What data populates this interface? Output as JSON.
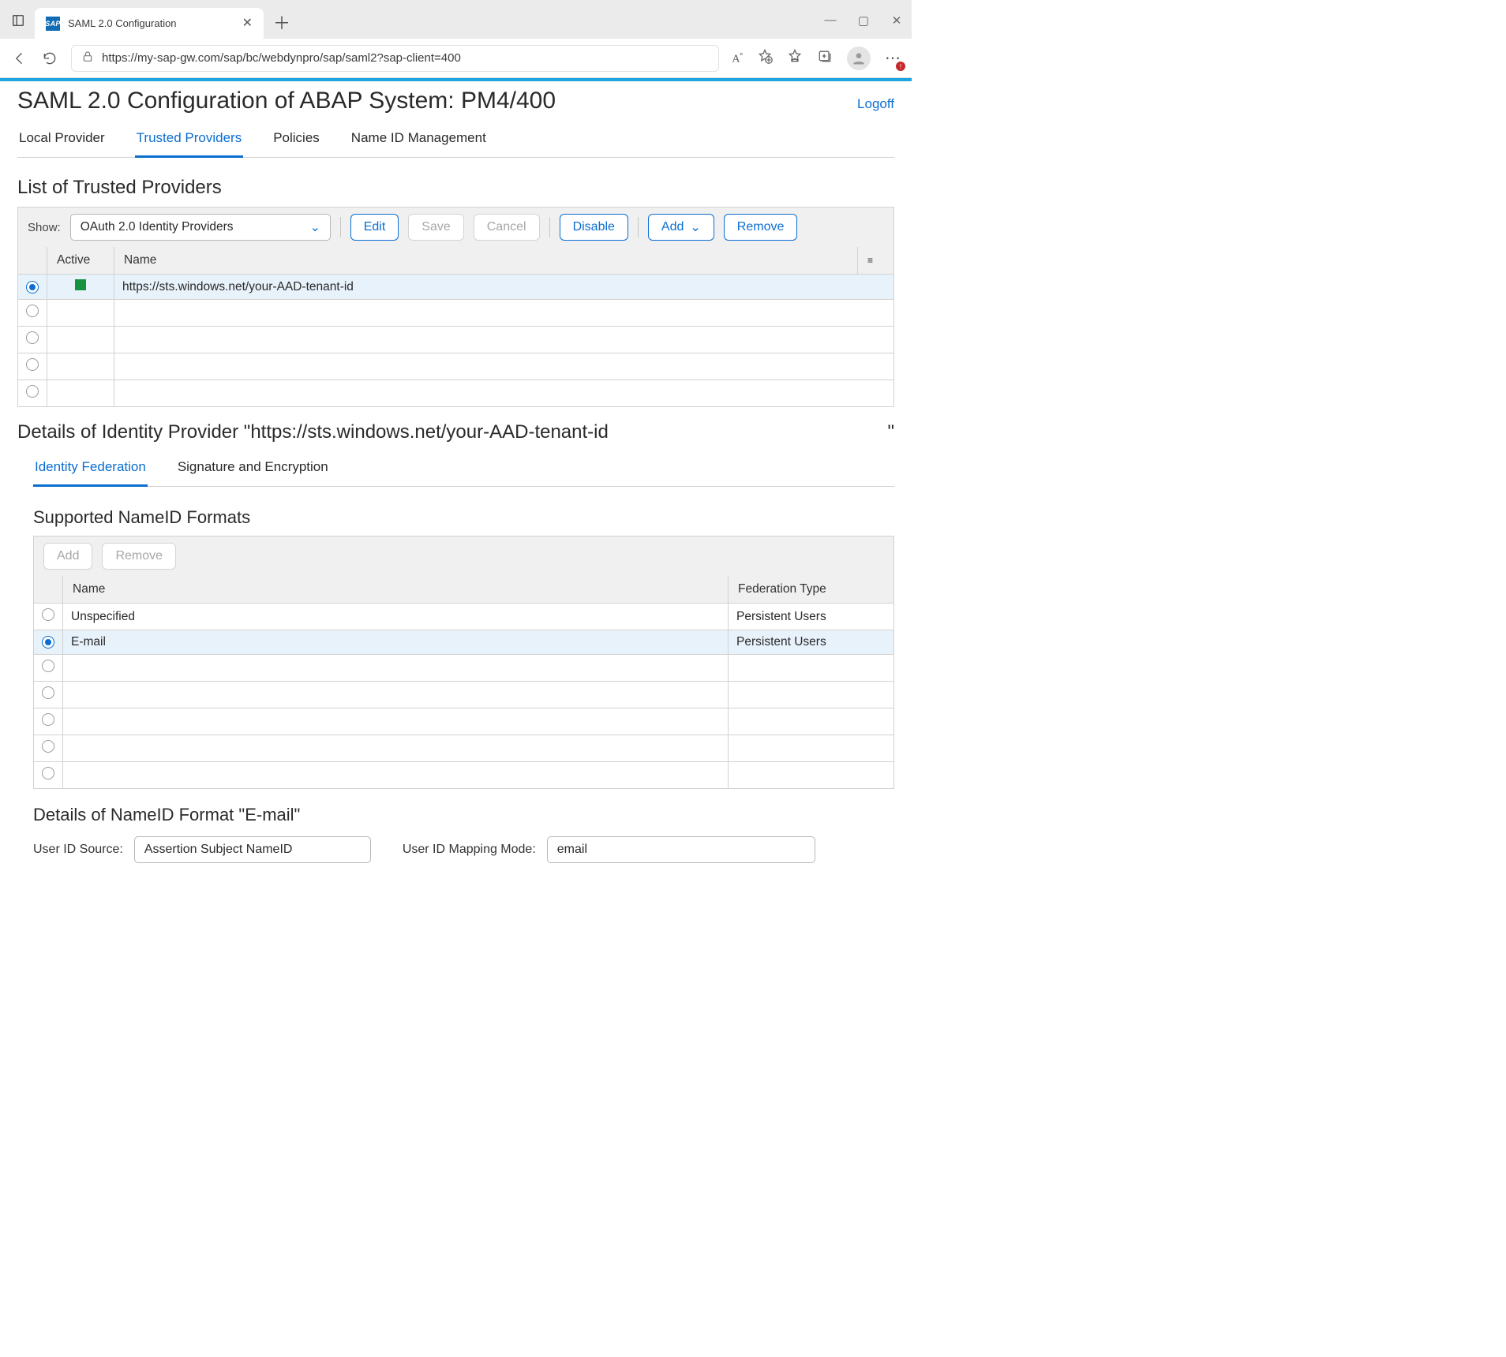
{
  "browser": {
    "tab_title": "SAML 2.0 Configuration",
    "url": "https://my-sap-gw.com/sap/bc/webdynpro/sap/saml2?sap-client=400"
  },
  "header": {
    "title": "SAML 2.0 Configuration of ABAP System: PM4/400",
    "logoff": "Logoff",
    "tabs": [
      "Local Provider",
      "Trusted Providers",
      "Policies",
      "Name ID Management"
    ],
    "active_tab_index": 1
  },
  "trusted": {
    "section_title": "List of Trusted Providers",
    "show_label": "Show:",
    "select_value": "OAuth 2.0 Identity Providers",
    "buttons": {
      "edit": "Edit",
      "save": "Save",
      "cancel": "Cancel",
      "disable": "Disable",
      "add": "Add",
      "remove": "Remove"
    },
    "columns": {
      "active": "Active",
      "name": "Name"
    },
    "rows": [
      {
        "selected": true,
        "active": true,
        "name_prefix": "https://sts.windows.net/",
        "name_suffix": "your-AAD-tenant-id"
      }
    ],
    "empty_rows": 4
  },
  "details": {
    "title_prefix": "Details of Identity Provider \"",
    "name_prefix": "https://sts.windows.net/",
    "name_suffix": "your-AAD-tenant-id",
    "title_trailing_quote": "\"",
    "sub_tabs": [
      "Identity Federation",
      "Signature and Encryption"
    ],
    "active_sub_tab_index": 0
  },
  "nameid": {
    "section_title": "Supported NameID Formats",
    "buttons": {
      "add": "Add",
      "remove": "Remove"
    },
    "columns": {
      "name": "Name",
      "fed": "Federation Type"
    },
    "rows": [
      {
        "selected": false,
        "name": "Unspecified",
        "fed": "Persistent Users"
      },
      {
        "selected": true,
        "name": "E-mail",
        "fed": "Persistent Users"
      }
    ],
    "empty_rows": 5
  },
  "nameid_detail": {
    "title": "Details of NameID Format \"E-mail\"",
    "source_label": "User ID Source:",
    "source_value": "Assertion Subject NameID",
    "mapping_label": "User ID Mapping Mode:",
    "mapping_value": "email"
  }
}
